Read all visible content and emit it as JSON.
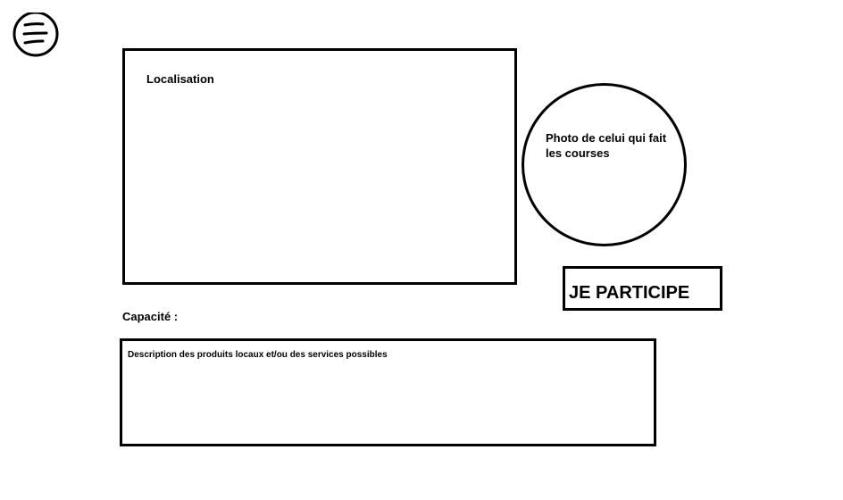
{
  "menu": {
    "icon": "hamburger-menu-icon"
  },
  "map_panel": {
    "label": "Localisation"
  },
  "photo_panel": {
    "label": "Photo de celui qui fait les courses"
  },
  "participate_button": {
    "label": "JE PARTICIPE"
  },
  "capacity": {
    "label": "Capacité :"
  },
  "description_panel": {
    "label": "Description des produits locaux et/ou des services possibles"
  }
}
